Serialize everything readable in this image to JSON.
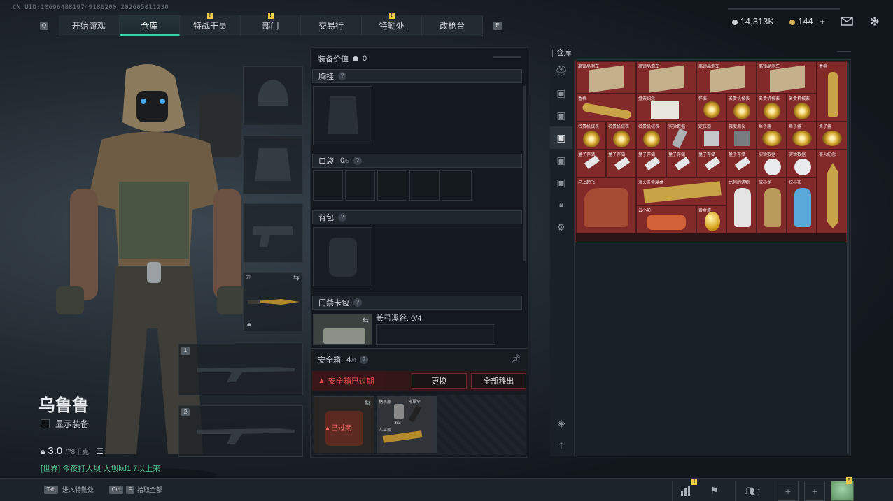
{
  "header": {
    "uid": "CN UID:1069648819749186200_202605011230",
    "nav_left_key": "Q",
    "nav_right_key": "E",
    "tabs": [
      {
        "label": "开始游戏",
        "active": false,
        "alert": false
      },
      {
        "label": "仓库",
        "active": true,
        "alert": false
      },
      {
        "label": "特战干员",
        "active": false,
        "alert": true
      },
      {
        "label": "部门",
        "active": false,
        "alert": true
      },
      {
        "label": "交易行",
        "active": false,
        "alert": false
      },
      {
        "label": "特勤处",
        "active": false,
        "alert": true
      },
      {
        "label": "改枪台",
        "active": false,
        "alert": false
      }
    ],
    "currency_1": "14,313K",
    "currency_2": "144",
    "plus": "+",
    "alert_mark": "!"
  },
  "character": {
    "name": "乌鲁鲁",
    "show_gear_label": "显示装备",
    "weight": "3.0",
    "weight_max": "/78千克",
    "chat": "[世界] 今夜打大坝 大坝kd1.7以上来",
    "melee_label": "刀",
    "weapon_slot_1": "1",
    "weapon_slot_2": "2"
  },
  "loadout": {
    "value_label": "装备价值",
    "value": "0",
    "chest_rig": "胸挂",
    "pockets_label": "口袋:",
    "pockets_used": "0",
    "pockets_max": "/5",
    "backpack": "背包",
    "keycard": "门禁卡包",
    "keycard_title": "长弓溪谷: 0/4",
    "q": "?",
    "safe_box_label": "安全箱:",
    "safe_box_used": "4",
    "safe_box_max": "/4",
    "expired_warning": "安全箱已过期",
    "replace_button": "更换",
    "remove_all_button": "全部移出",
    "expired_badge": "已过期",
    "safebox_item_1": "糖果瓶",
    "safebox_item_2": "将军令",
    "safebox_item_3": "人工蛋",
    "safebox_count": "3/3"
  },
  "warehouse": {
    "title": "仓库",
    "items": [
      {
        "name": "离锁晶测车"
      },
      {
        "name": "离锁晶测车"
      },
      {
        "name": "离锁晶测车"
      },
      {
        "name": "离锁晶测车"
      },
      {
        "name": "香槟"
      },
      {
        "name": "香槟"
      },
      {
        "name": "盘典纪念"
      },
      {
        "name": "怀表"
      },
      {
        "name": "名贵机械表"
      },
      {
        "name": "名贵机械表"
      },
      {
        "name": "名贵机械表"
      },
      {
        "name": "名贵机械表"
      },
      {
        "name": "名贵机械表"
      },
      {
        "name": "名贵机械表"
      },
      {
        "name": "实验数据"
      },
      {
        "name": "定位器"
      },
      {
        "name": "强度测仪"
      },
      {
        "name": "鱼子酱"
      },
      {
        "name": "鱼子酱"
      },
      {
        "name": "鱼子酱"
      },
      {
        "name": "量子存储"
      },
      {
        "name": "量子存储"
      },
      {
        "name": "量子存储"
      },
      {
        "name": "量子存储"
      },
      {
        "name": "量子存储"
      },
      {
        "name": "量子存储"
      },
      {
        "name": "实验数据"
      },
      {
        "name": "实验数据"
      },
      {
        "name": "非火纪念"
      },
      {
        "name": "马上起飞"
      },
      {
        "name": "滑火炙金属桌"
      },
      {
        "name": "比利的遗物"
      },
      {
        "name": "威小龙"
      },
      {
        "name": "拉小布"
      },
      {
        "name": "云小彩"
      },
      {
        "name": "黄金蛋"
      }
    ]
  },
  "footer": {
    "key_1": "Tab",
    "label_1": "进入特勤处",
    "key_2": "Ctrl",
    "key_2b": "F",
    "label_2": "拾取全部",
    "squad_count": "1"
  },
  "colors": {
    "accent": "#35d1a5",
    "warning": "#e64b4b",
    "item_bg": "#822a2a",
    "alert": "#f1c94b"
  },
  "icons": [
    "helmet-icon",
    "armor-icon",
    "pistol-icon",
    "knife-icon",
    "rifle-icon",
    "mail-icon",
    "gear-icon",
    "lock-icon",
    "layers-icon",
    "upload-icon",
    "chart-icon",
    "flag-icon",
    "friend-icon",
    "plus-icon",
    "avatar"
  ]
}
